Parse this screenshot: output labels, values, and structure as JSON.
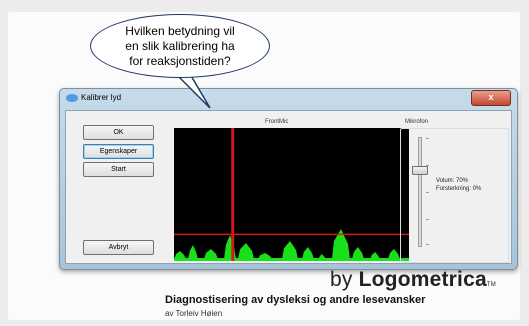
{
  "callout": {
    "text": "Hvilken betydning vil\nen slik kalibrering ha\nfor reaksjonstiden?"
  },
  "window": {
    "title": "Kalibrer lyd",
    "close_label": "x",
    "buttons": {
      "ok": "OK",
      "properties": "Egenskaper",
      "start": "Start",
      "cancel": "Avbryt"
    },
    "scope": {
      "label": "FrontMic",
      "bg_color": "#000000",
      "threshold_color": "#d01a1a",
      "signal_color": "#19e019",
      "threshold_level": 0.2,
      "marker_position": 0.25
    },
    "microphone": {
      "label": "Mikrofon",
      "volume_text": "Volum: 70%",
      "boost_text": "Forsterkning: 0%",
      "volume_level": 0.7
    }
  },
  "branding": {
    "by": "by ",
    "name": "Logometrica",
    "tm": "TM",
    "heading": "Diagnostisering av dysleksi og andre lesevansker",
    "byline": "av Torleiv Høien"
  }
}
